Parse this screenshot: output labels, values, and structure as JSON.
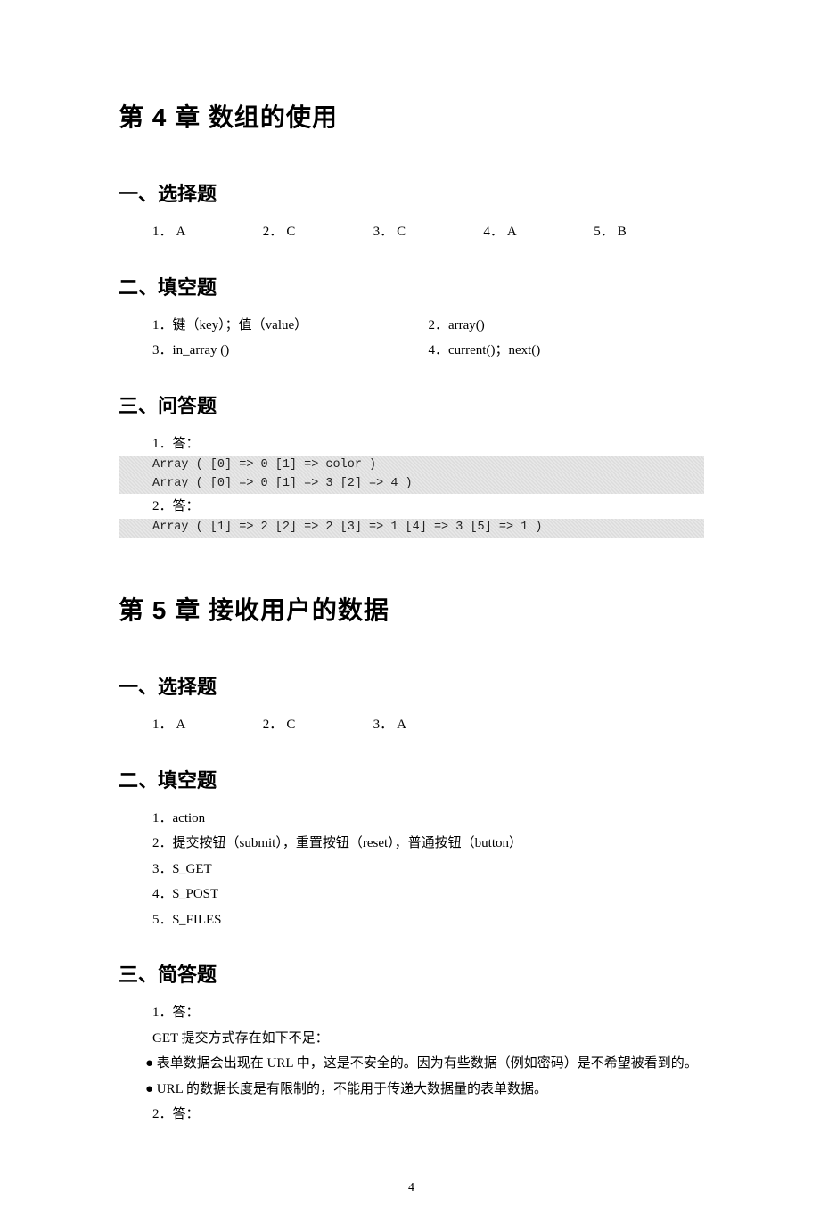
{
  "chapters": [
    {
      "title": "第 4 章    数组的使用",
      "sections": [
        {
          "title": "一、选择题",
          "type": "choice",
          "items": [
            {
              "num": "1．",
              "ans": "A"
            },
            {
              "num": "2．",
              "ans": "C"
            },
            {
              "num": "3．",
              "ans": "C"
            },
            {
              "num": "4．",
              "ans": "A"
            },
            {
              "num": "5．",
              "ans": "B"
            }
          ]
        },
        {
          "title": "二、填空题",
          "type": "fill2col",
          "rows": [
            {
              "l": "1．键（key）；值（value）",
              "r": "2．array()"
            },
            {
              "l": "3．in_array ()",
              "r": "4．current()；next()"
            }
          ]
        },
        {
          "title": "三、问答题",
          "type": "qa-code",
          "blocks": [
            {
              "label": "1．答：",
              "code": [
                "Array ( [0] => 0 [1] => color )",
                "Array ( [0] => 0 [1] => 3 [2] => 4 )"
              ]
            },
            {
              "label": "2．答：",
              "code": [
                "Array ( [1] => 2 [2] => 2 [3] => 1 [4] => 3 [5] => 1 )"
              ]
            }
          ]
        }
      ]
    },
    {
      "title": "第 5 章    接收用户的数据",
      "sections": [
        {
          "title": "一、选择题",
          "type": "choice",
          "items": [
            {
              "num": "1．",
              "ans": "A"
            },
            {
              "num": "2．",
              "ans": "C"
            },
            {
              "num": "3．",
              "ans": "A"
            }
          ]
        },
        {
          "title": "二、填空题",
          "type": "fill-list",
          "items": [
            "1．action",
            "2．提交按钮（submit），重置按钮（reset），普通按钮（button）",
            "3．$_GET",
            "4．$_POST",
            "5．$_FILES"
          ]
        },
        {
          "title": "三、简答题",
          "type": "essay",
          "lines": [
            {
              "text": "1．答：",
              "indent": true
            },
            {
              "text": "GET 提交方式存在如下不足：",
              "indent": true
            },
            {
              "text": "● 表单数据会出现在 URL 中，这是不安全的。因为有些数据（例如密码）是不希望被看到的。",
              "indent": true,
              "hang": true
            },
            {
              "text": "● URL 的数据长度是有限制的，不能用于传递大数据量的表单数据。",
              "indent": true
            },
            {
              "text": "2．答：",
              "indent": true
            }
          ]
        }
      ]
    }
  ],
  "page_number": "4"
}
